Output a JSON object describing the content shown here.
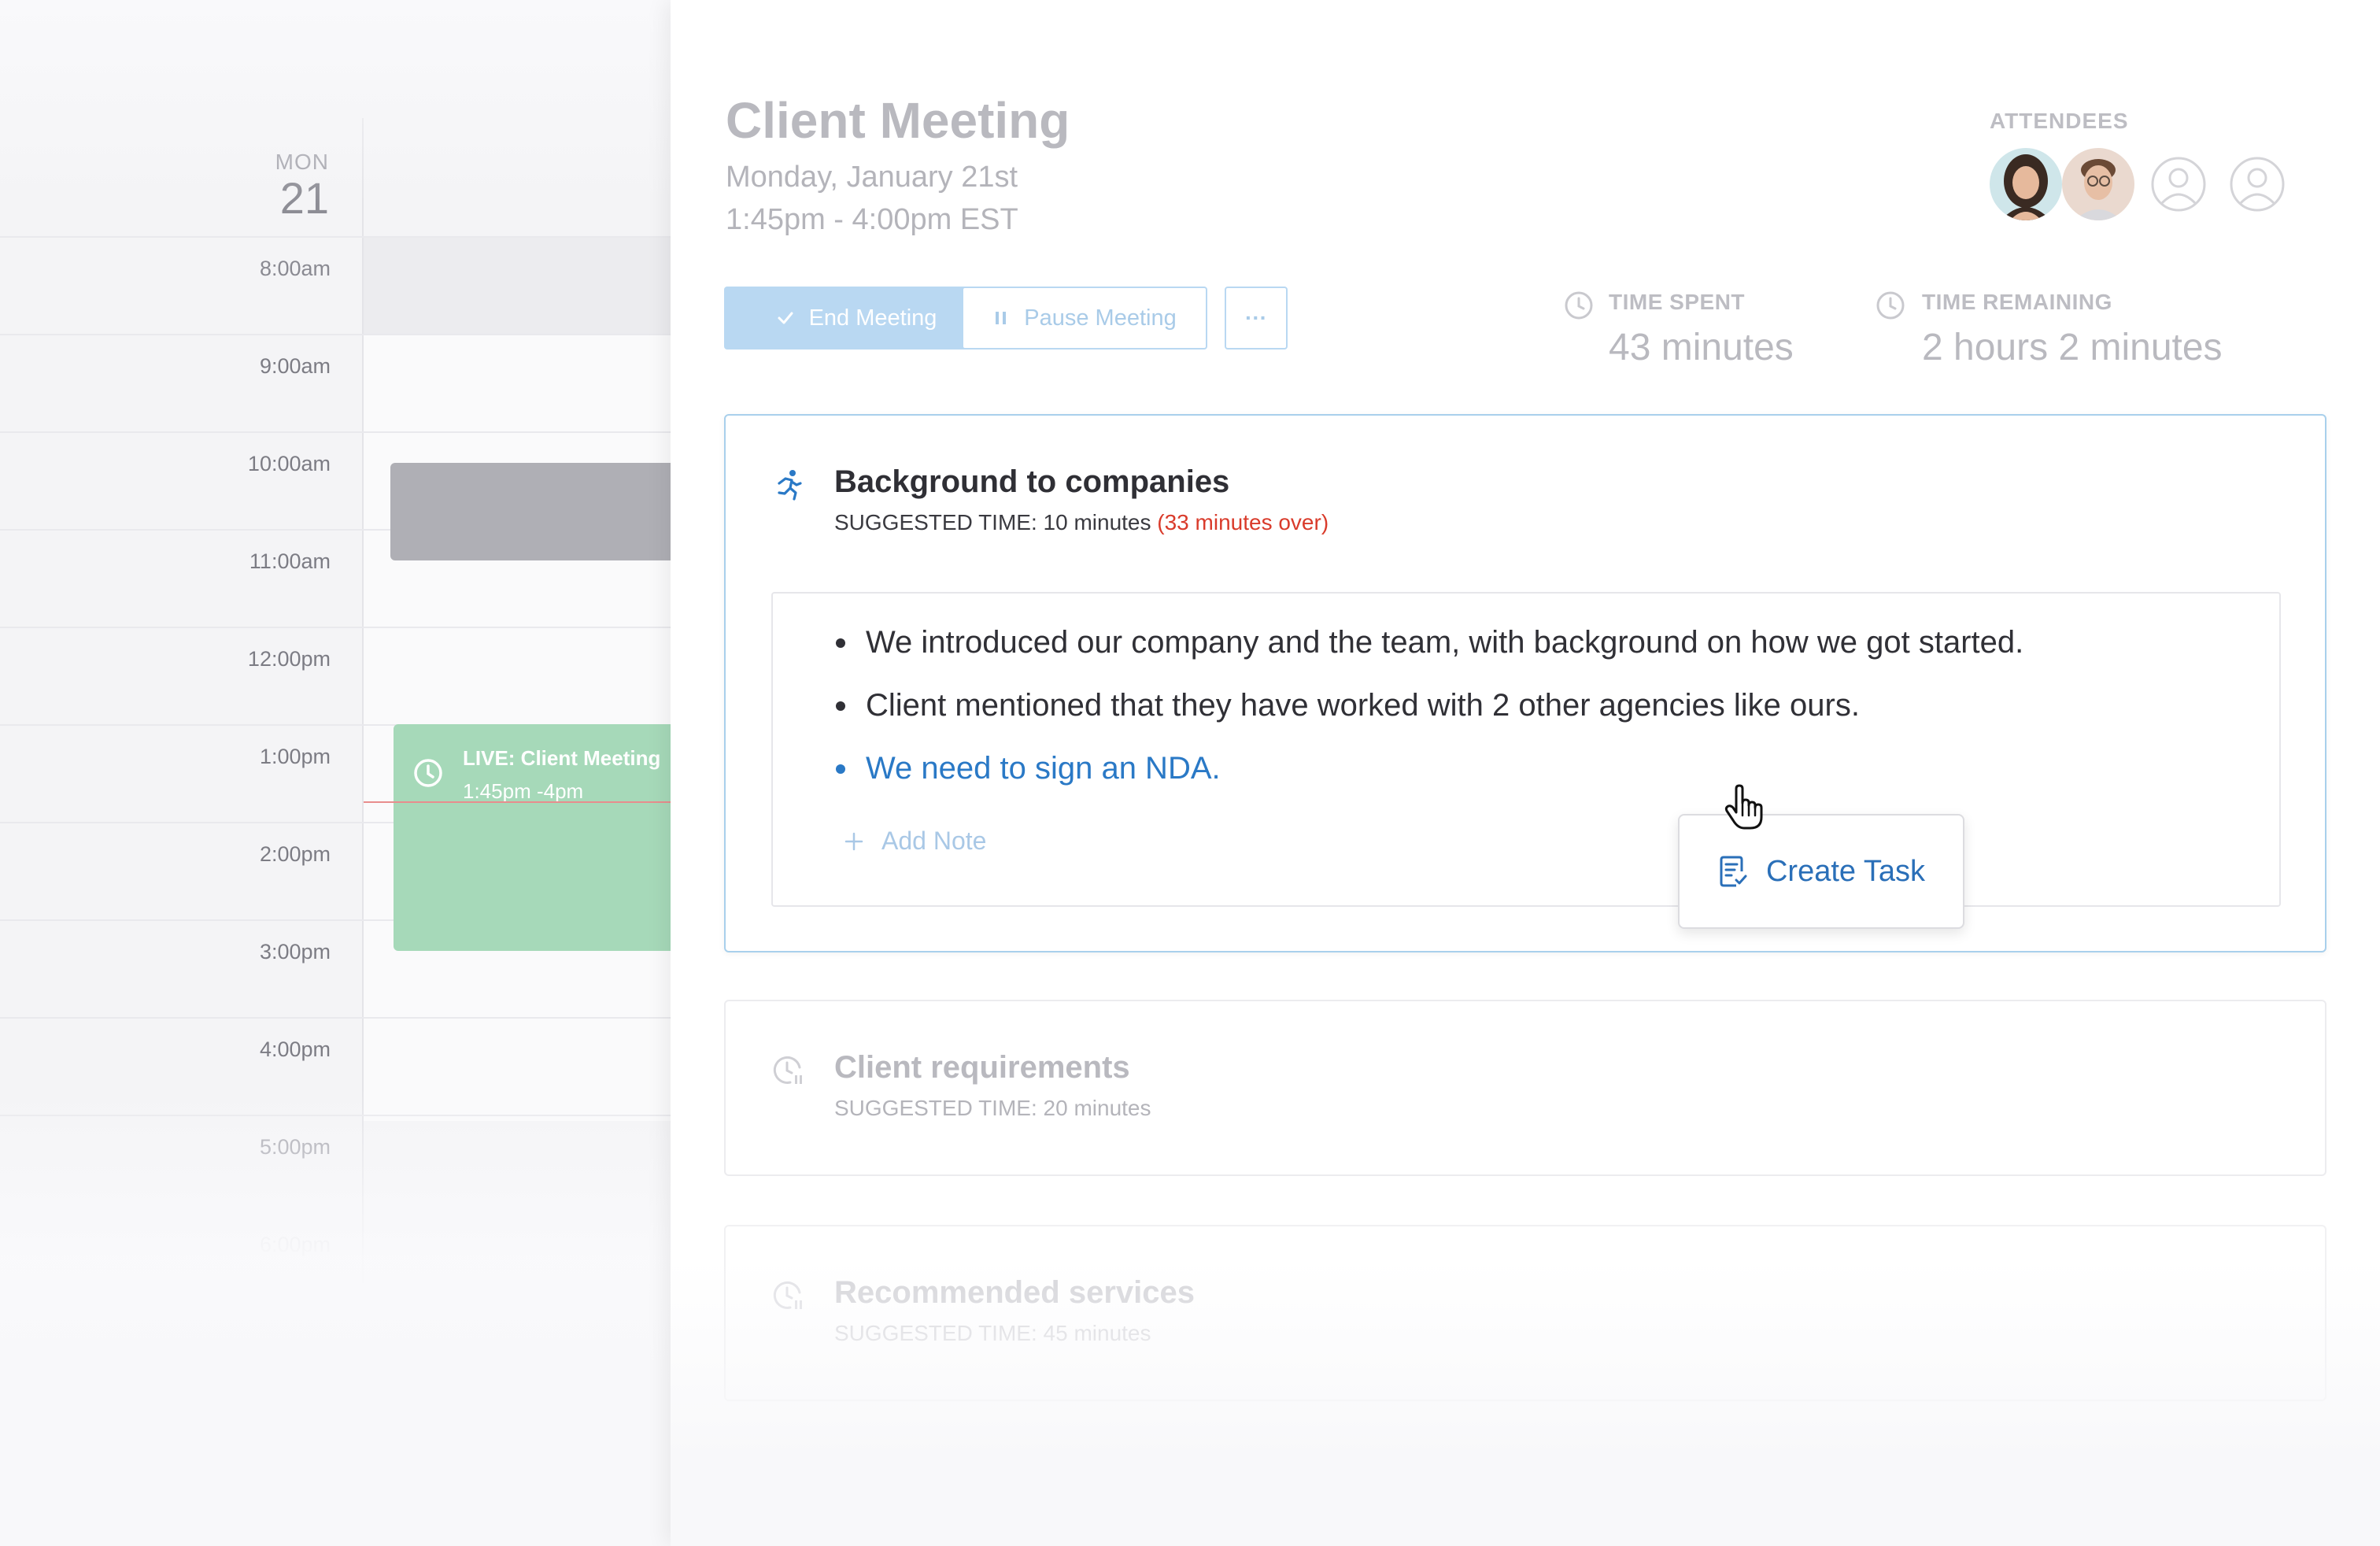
{
  "calendar": {
    "day_name": "MON",
    "day_number": "21",
    "hours": [
      "8:00am",
      "9:00am",
      "10:00am",
      "11:00am",
      "12:00pm",
      "1:00pm",
      "2:00pm",
      "3:00pm",
      "4:00pm",
      "5:00pm",
      "6:00pm"
    ],
    "live_event": {
      "title": "LIVE: Client Meeting",
      "time": "1:45pm -4pm"
    },
    "colors": {
      "live_event": "#a6d9b9",
      "gray_event": "#afafb5",
      "now_line": "#e88d8d"
    }
  },
  "meeting": {
    "title": "Client Meeting",
    "date": "Monday, January 21st",
    "time": "1:45pm - 4:00pm EST",
    "attendees_label": "ATTENDEES",
    "actions": {
      "end_label": "End Meeting",
      "pause_label": "Pause Meeting",
      "more_label": "···"
    },
    "time_spent": {
      "label": "TIME SPENT",
      "value": "43 minutes"
    },
    "time_remaining": {
      "label": "TIME REMAINING",
      "value": "2 hours 2 minutes"
    }
  },
  "agenda": [
    {
      "title": "Background to companies",
      "suggested": "SUGGESTED TIME: 10 minutes",
      "over": "(33 minutes over)",
      "notes": [
        "We introduced our company and the team, with background on how we got started.",
        "Client mentioned that they have worked with 2 other agencies like ours.",
        "We need to sign an NDA."
      ],
      "add_note_label": "Add Note",
      "popover_label": "Create Task"
    },
    {
      "title": "Client requirements",
      "suggested": "SUGGESTED TIME: 20 minutes"
    },
    {
      "title": "Recommended services",
      "suggested": "SUGGESTED TIME: 45 minutes"
    }
  ],
  "colors": {
    "accent": "#2a79c6",
    "overtime": "#d93b2b",
    "active_border": "#a9d0ec"
  }
}
